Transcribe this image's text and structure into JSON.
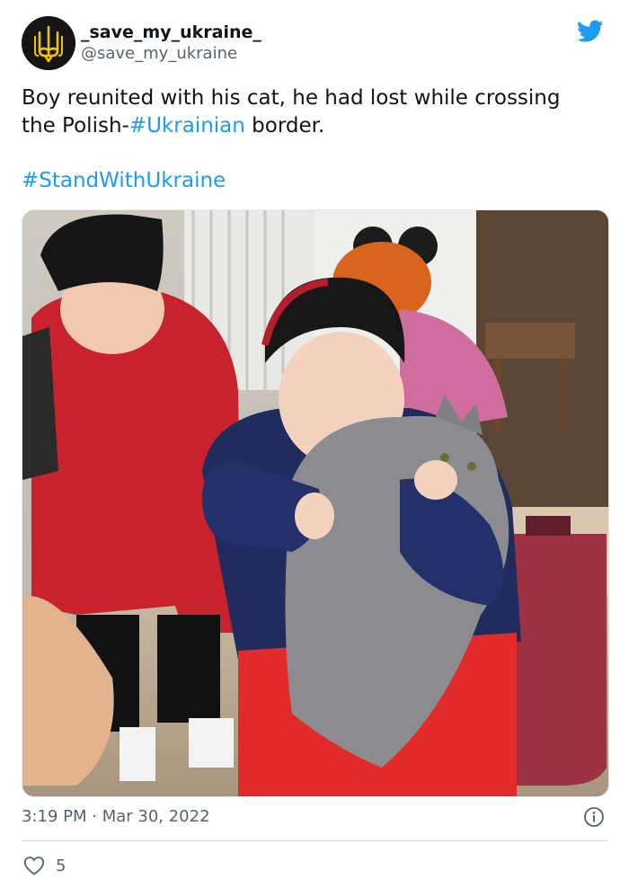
{
  "author": {
    "display_name": "_save_my_ukraine_",
    "handle": "@save_my_ukraine",
    "avatar_icon": "trident-icon"
  },
  "tweet": {
    "text_line1_prefix": "Boy reunited with his cat, he had lost while crossing the Polish-",
    "hashtag_ukrainian": "#Ukrainian",
    "text_line1_suffix": " border.",
    "hashtag_stand": "#StandWithUkraine"
  },
  "meta": {
    "time": "3:19 PM",
    "separator": " · ",
    "date": "Mar 30, 2022"
  },
  "engagement": {
    "like_count": "5"
  },
  "colors": {
    "link": "#1d9bf0",
    "secondary_text": "#536471",
    "twitter_blue": "#1d9bf0"
  }
}
